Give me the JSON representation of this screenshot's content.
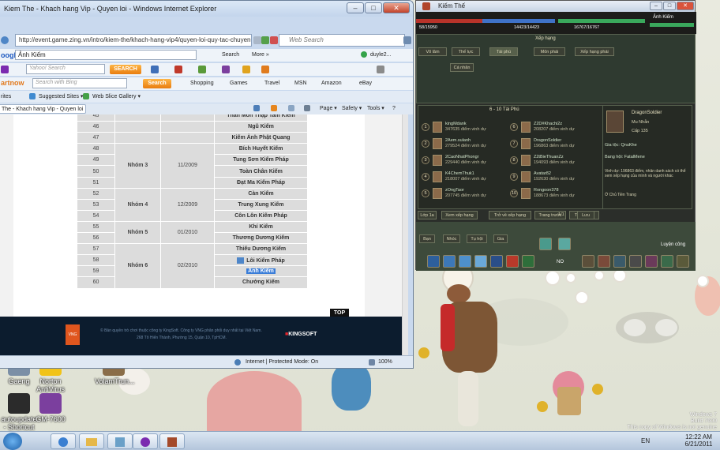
{
  "desktop": {
    "icons": [
      {
        "label": "Gaeng"
      },
      {
        "label": "Norton AntiVirus"
      },
      {
        "label": "VolamTrun..."
      },
      {
        "label": "autoupdate - Shortcut"
      },
      {
        "label": "GM-7600"
      }
    ],
    "watermark": {
      "line1": "Windows 7",
      "line2": "Build 7600",
      "line3": "This copy of Windows is not genuine"
    }
  },
  "ie": {
    "title": "Kiem The - Khach hang Vip - Quyen loi - Windows Internet Explorer",
    "url": "http://event.game.zing.vn/intro/kiem-the/khach-hang-vip4/quyen-loi-quy-tac-chuyen-server",
    "search_placeholder": "Web Search",
    "toolbar1": {
      "brand": "oogle",
      "query": "Ảnh Kiếm",
      "search_label": "Search",
      "more_label": "More »",
      "user_label": "duyle2..."
    },
    "toolbar2": {
      "search_placeholder": "Yahoo! Search",
      "search_btn": "SEARCH"
    },
    "toolbar3": {
      "brand": "artnow",
      "search_placeholder": "Search with Bing",
      "search_btn": "Search",
      "links": [
        "Shopping",
        "Games",
        "Travel",
        "MSN",
        "Amazon",
        "eBay"
      ]
    },
    "favorites": {
      "label": "rites",
      "suggested": "Suggested Sites ▾",
      "webslice": "Web Slice Gallery ▾"
    },
    "tab": {
      "label": "The - Khach hang Vip - Quyen loi"
    },
    "cmd": {
      "page": "Page ▾",
      "safety": "Safety ▾",
      "tools": "Tools ▾",
      "help": "?"
    },
    "table": {
      "rows": [
        {
          "n": "45",
          "server": "Thần Môn Thập Tam Kiếm"
        },
        {
          "n": "46",
          "server": "Ngũ Kiếm"
        },
        {
          "n": "47",
          "server": "Kiếm Ảnh Phật Quang"
        },
        {
          "n": "48",
          "server": "Bích Huyết Kiếm"
        },
        {
          "n": "49",
          "server": "Tung Sơn Kiếm Pháp"
        },
        {
          "n": "50",
          "server": "Toàn Chân Kiếm"
        },
        {
          "n": "51",
          "server": "Đạt Ma Kiếm Pháp"
        },
        {
          "n": "52",
          "server": "Càn Kiếm"
        },
        {
          "n": "53",
          "server": "Trung Xung Kiếm"
        },
        {
          "n": "54",
          "server": "Côn Lôn Kiếm Pháp"
        },
        {
          "n": "55",
          "server": "Khí Kiếm"
        },
        {
          "n": "56",
          "server": "Thương Dương Kiếm"
        },
        {
          "n": "57",
          "server": "Thiếu Dương Kiếm"
        },
        {
          "n": "58",
          "server": "Lôi Kiếm Pháp"
        },
        {
          "n": "59",
          "server": "Ảnh Kiếm"
        },
        {
          "n": "60",
          "server": "Chướng Kiếm"
        }
      ],
      "groups": [
        {
          "name": "Nhóm 3",
          "date": "11/2009"
        },
        {
          "name": "Nhóm 4",
          "date": "12/2009"
        },
        {
          "name": "Nhóm 5",
          "date": "01/2010"
        },
        {
          "name": "Nhóm 6",
          "date": "02/2010"
        }
      ]
    },
    "top_label": "TOP",
    "footer": {
      "line1": "© Bản quyền trò chơi thuộc công ty KingSoft. Công ty VNG phân phối duy nhất tại Việt Nam.",
      "line2": "268 Tô Hiến Thành, Phường 15, Quận 10, TpHCM.",
      "kingsoft": "KINGSOFT",
      "vng": "VNG"
    },
    "status": {
      "zone": "Internet | Protected Mode: On",
      "zoom": "100%"
    }
  },
  "game": {
    "title": "Kiếm Thế",
    "hud": {
      "hp": "58/15950",
      "mp": "14423/14423",
      "stamina": "16767/16767",
      "player": "Ảnh Kiếm"
    },
    "rank_header": "Xếp hạng",
    "tabs": [
      "Võ lâm",
      "Thế lực",
      "Tài phú",
      "Môn phái",
      "Xếp hạng phái"
    ],
    "subtab": "Cá nhân",
    "panel_title": "6 - 10 Tài Phú",
    "ranks": [
      {
        "num": "1",
        "name": "kingMdank",
        "points": "347635 điểm vinh dự"
      },
      {
        "num": "2",
        "name": "2Aem.sulanh",
        "points": "279524 điểm vinh dự"
      },
      {
        "num": "3",
        "name": "2CaoNhatPhongr",
        "points": "229440 điểm vinh dự"
      },
      {
        "num": "4",
        "name": "K4ChemThuk1",
        "points": "218007 điểm vinh dự"
      },
      {
        "num": "5",
        "name": "zOngTaor",
        "points": "207745 điểm vinh dự"
      },
      {
        "num": "6",
        "name": "Z2D#Khachi2z",
        "points": "208207 điểm vinh dự"
      },
      {
        "num": "7",
        "name": "DragonSoldier",
        "points": "196863 điểm vinh dự"
      },
      {
        "num": "8",
        "name": "Z2tBieThuanZz",
        "points": "194093 điểm vinh dự"
      },
      {
        "num": "9",
        "name": "Avatar82",
        "points": "192630 điểm vinh dự"
      },
      {
        "num": "10",
        "name": "Rongoon378",
        "points": "188673 điểm vinh dự"
      }
    ],
    "profile": {
      "name": "DragonSoldier",
      "class": "Mu Nhẫn",
      "level": "Cấp 135",
      "clan": "Gia tộc: QnuKhe",
      "faction": "Bang hội: FatalMene",
      "desc": "Vinh dự: 196863 điểm, nhân danh sách có thể xem xếp hạng của mình và người khác",
      "sign": "Ở Chủ Tiền Trang"
    },
    "bottom_tabs": [
      "Lớp 1a",
      "Xem xếp hạng",
      "Trở về xếp hạng",
      "Trang trước",
      "Trang sau",
      "1/1",
      "Lưu"
    ],
    "chat_tabs": [
      "Bạn",
      "Nhóc",
      "Tụ hội",
      "Gia"
    ],
    "train_label": "Luyện công",
    "slot_label": "NO"
  },
  "taskbar": {
    "time": "12:22 AM",
    "date": "6/21/2011",
    "lang": "EN"
  }
}
